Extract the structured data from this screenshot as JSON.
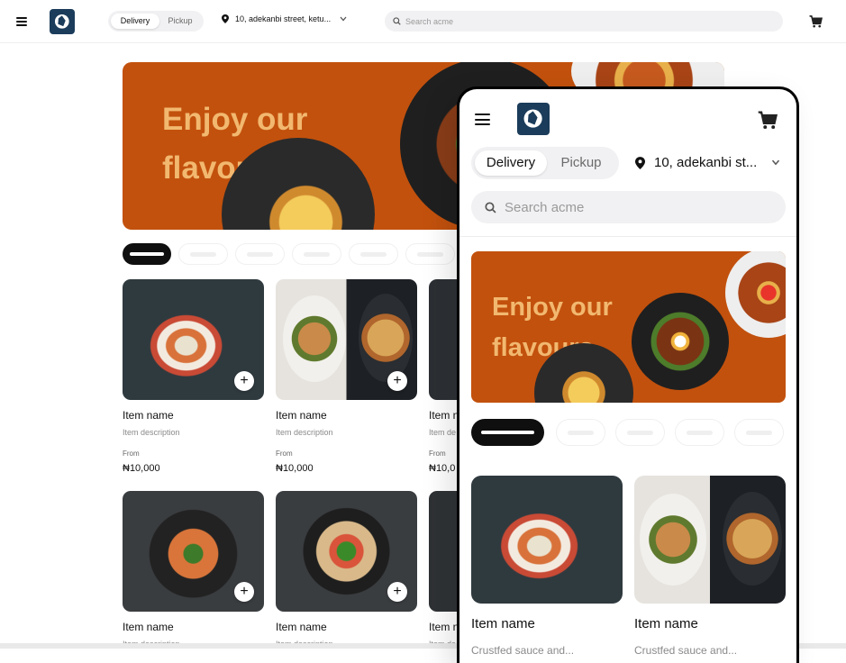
{
  "header": {
    "delivery_label": "Delivery",
    "pickup_label": "Pickup",
    "address": "10, adekanbi street, ketu...",
    "search_placeholder": "Search acme"
  },
  "hero": {
    "line1": "Enjoy our",
    "line2": "flavours"
  },
  "products": [
    {
      "name": "Item name",
      "description": "Item description",
      "from_label": "From",
      "price": "₦10,000"
    },
    {
      "name": "Item name",
      "description": "Item description",
      "from_label": "From",
      "price": "₦10,000"
    },
    {
      "name": "Item name",
      "description": "Item de",
      "from_label": "From",
      "price": "₦10,0"
    },
    {
      "name": "Item name",
      "description": "Item description"
    },
    {
      "name": "Item name",
      "description": "Item description"
    },
    {
      "name": "Item name",
      "description": "Item de"
    }
  ],
  "phone": {
    "delivery_label": "Delivery",
    "pickup_label": "Pickup",
    "address": "10, adekanbi st...",
    "search_placeholder": "Search acme",
    "hero": {
      "line1": "Enjoy our",
      "line2": "flavours"
    },
    "products": [
      {
        "name": "Item name",
        "description": "Crustfed sauce and..."
      },
      {
        "name": "Item name",
        "description": "Crustfed sauce and..."
      }
    ]
  },
  "colors": {
    "brand_orange": "#c2510d",
    "hero_text": "#f2b870",
    "logo_navy": "#1b3c5a"
  },
  "icons": [
    "hamburger-icon",
    "logo-icon",
    "location-pin-icon",
    "chevron-down-icon",
    "search-icon",
    "cart-icon",
    "plus-icon"
  ]
}
